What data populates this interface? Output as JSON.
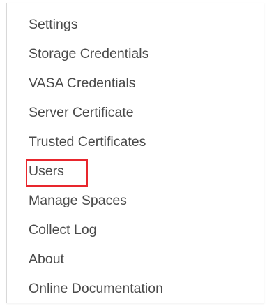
{
  "menu": {
    "items": [
      {
        "label": "Settings"
      },
      {
        "label": "Storage Credentials"
      },
      {
        "label": "VASA Credentials"
      },
      {
        "label": "Server Certificate"
      },
      {
        "label": "Trusted Certificates"
      },
      {
        "label": "Users",
        "highlighted": true
      },
      {
        "label": "Manage Spaces"
      },
      {
        "label": "Collect Log"
      },
      {
        "label": "About"
      },
      {
        "label": "Online Documentation"
      }
    ],
    "highlight_color": "#e8262d",
    "text_color": "#4a4a4a"
  }
}
